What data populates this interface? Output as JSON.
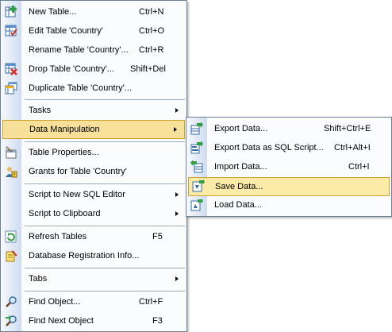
{
  "main_menu": {
    "items": [
      {
        "label": "New Table...",
        "shortcut": "Ctrl+N",
        "icon": "new-table-icon"
      },
      {
        "label": "Edit Table 'Country'",
        "shortcut": "Ctrl+O",
        "icon": "edit-table-icon"
      },
      {
        "label": "Rename Table 'Country'...",
        "shortcut": "Ctrl+R",
        "icon": ""
      },
      {
        "label": "Drop Table 'Country'...",
        "shortcut": "Shift+Del",
        "icon": "drop-table-icon"
      },
      {
        "label": "Duplicate Table 'Country'...",
        "shortcut": "",
        "icon": "duplicate-table-icon"
      },
      {
        "label": "Tasks",
        "shortcut": "",
        "icon": "",
        "submenu": true
      },
      {
        "label": "Data Manipulation",
        "shortcut": "",
        "icon": "",
        "submenu": true,
        "highlighted": true
      },
      {
        "label": "Table Properties...",
        "shortcut": "",
        "icon": "table-properties-icon"
      },
      {
        "label": "Grants for Table 'Country'",
        "shortcut": "",
        "icon": "grants-icon"
      },
      {
        "label": "Script to New SQL Editor",
        "shortcut": "",
        "icon": "",
        "submenu": true
      },
      {
        "label": "Script to Clipboard",
        "shortcut": "",
        "icon": "",
        "submenu": true
      },
      {
        "label": "Refresh Tables",
        "shortcut": "F5",
        "icon": "refresh-icon"
      },
      {
        "label": "Database Registration Info...",
        "shortcut": "",
        "icon": "registration-info-icon"
      },
      {
        "label": "Tabs",
        "shortcut": "",
        "icon": "",
        "submenu": true
      },
      {
        "label": "Find Object...",
        "shortcut": "Ctrl+F",
        "icon": "find-object-icon"
      },
      {
        "label": "Find Next Object",
        "shortcut": "F3",
        "icon": "find-next-icon"
      }
    ]
  },
  "sub_menu": {
    "items": [
      {
        "label": "Export Data...",
        "shortcut": "Shift+Ctrl+E",
        "icon": "export-data-icon"
      },
      {
        "label": "Export Data as SQL Script...",
        "shortcut": "Ctrl+Alt+I",
        "icon": "export-sql-icon"
      },
      {
        "label": "Import Data...",
        "shortcut": "Ctrl+I",
        "icon": "import-data-icon"
      },
      {
        "label": "Save Data...",
        "shortcut": "",
        "icon": "save-data-icon",
        "highlighted": true
      },
      {
        "label": "Load Data...",
        "shortcut": "",
        "icon": "load-data-icon"
      }
    ]
  },
  "colors": {
    "highlight_fill": "#f6e09a",
    "highlight_border": "#c9a233",
    "menu_border": "#6b7f99"
  }
}
